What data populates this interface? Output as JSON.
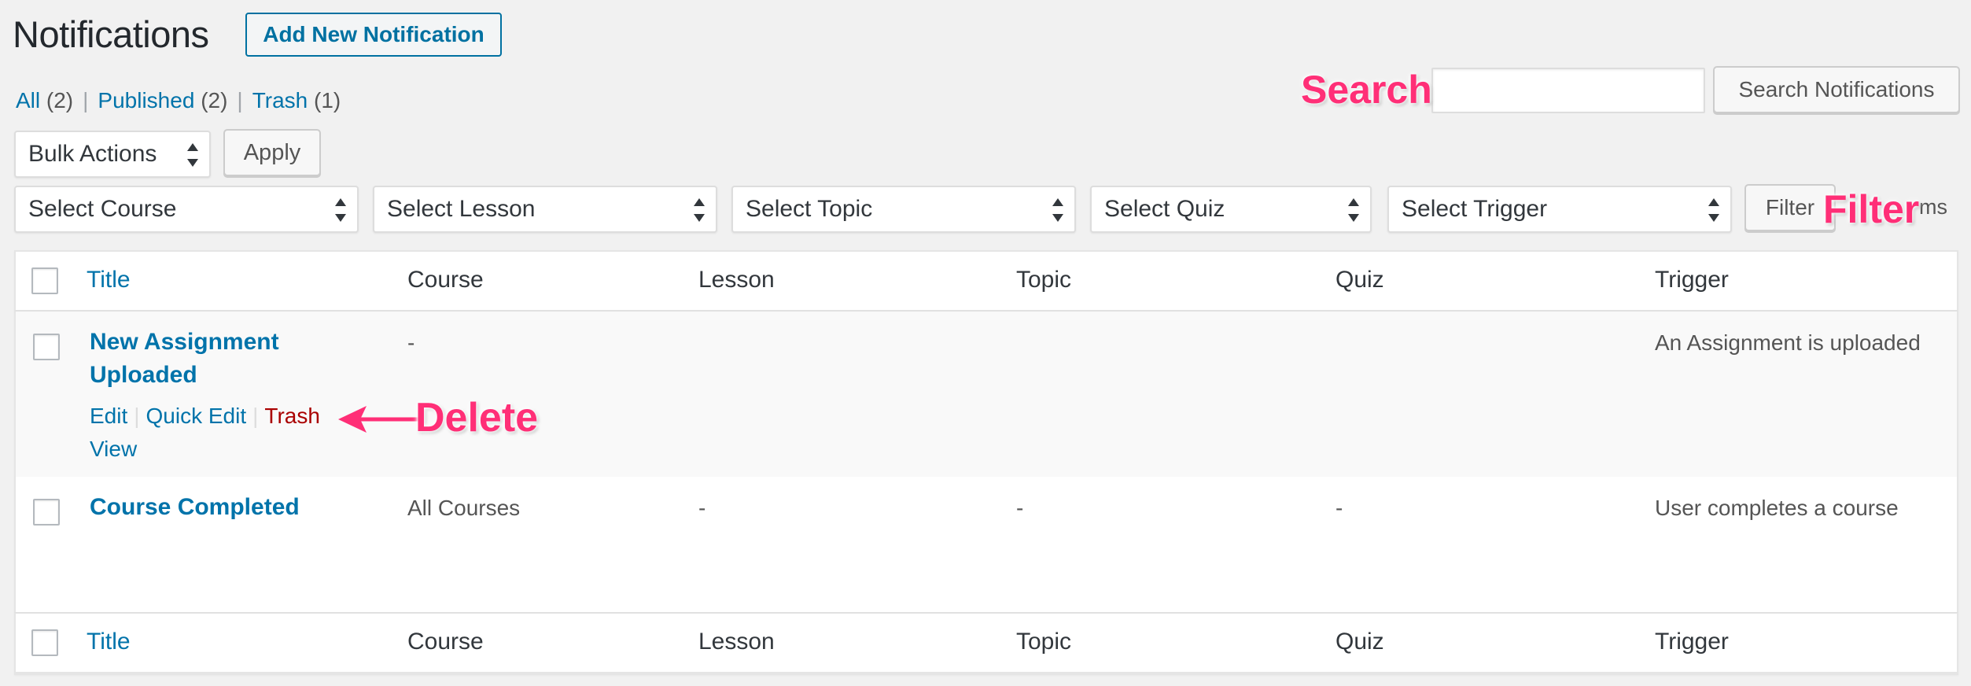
{
  "header": {
    "title": "Notifications",
    "add_new_label": "Add New Notification"
  },
  "views": {
    "all_label": "All",
    "all_count": "(2)",
    "published_label": "Published",
    "published_count": "(2)",
    "trash_label": "Trash",
    "trash_count": "(1)",
    "separator": "|"
  },
  "search": {
    "annotation": "Search",
    "placeholder": "",
    "value": "",
    "button_label": "Search Notifications"
  },
  "bulk": {
    "selected": "Bulk Actions",
    "apply_label": "Apply"
  },
  "filters": {
    "course": "Select Course",
    "lesson": "Select Lesson",
    "topic": "Select Topic",
    "quiz": "Select Quiz",
    "trigger": "Select Trigger",
    "button_label": "Filter",
    "annotation": "Filter",
    "items_count_partial": "ms"
  },
  "table": {
    "columns": [
      "Title",
      "Course",
      "Lesson",
      "Topic",
      "Quiz",
      "Trigger"
    ],
    "rows": [
      {
        "title_line1": "New Assignment",
        "title_line2": "Uploaded",
        "course": "-",
        "lesson": "",
        "topic": "",
        "quiz": "",
        "trigger": "An Assignment is uploaded",
        "actions": {
          "edit": "Edit",
          "quick_edit": "Quick Edit",
          "trash": "Trash",
          "view": "View",
          "separator": "|"
        }
      },
      {
        "title_line1": "Course Completed",
        "course": "All Courses",
        "lesson": "-",
        "topic": "-",
        "quiz": "-",
        "trigger": "User completes a course"
      }
    ]
  },
  "annotations": {
    "delete": "Delete",
    "color": "#ff2f77"
  },
  "colors": {
    "link": "#0073aa",
    "trash": "#aa0000",
    "background": "#f1f1f1"
  }
}
